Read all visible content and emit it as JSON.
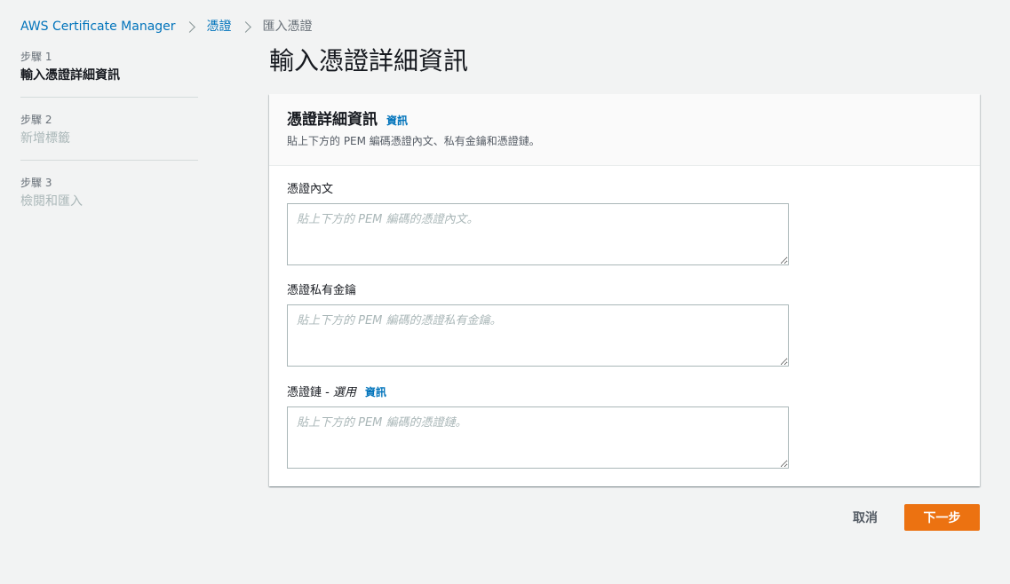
{
  "breadcrumb": {
    "items": [
      "AWS Certificate Manager",
      "憑證"
    ],
    "current": "匯入憑證"
  },
  "steps": [
    {
      "num": "步驟 1",
      "title": "輸入憑證詳細資訊",
      "active": true
    },
    {
      "num": "步驟 2",
      "title": "新增標籤",
      "active": false
    },
    {
      "num": "步驟 3",
      "title": "檢閱和匯入",
      "active": false
    }
  ],
  "page_title": "輸入憑證詳細資訊",
  "panel": {
    "title": "憑證詳細資訊",
    "info_label": "資訊",
    "description": "貼上下方的 PEM 編碼憑證內文、私有金鑰和憑證鏈。"
  },
  "fields": {
    "body": {
      "label": "憑證內文",
      "placeholder": "貼上下方的 PEM 編碼的憑證內文。"
    },
    "private_key": {
      "label": "憑證私有金鑰",
      "placeholder": "貼上下方的 PEM 編碼的憑證私有金鑰。"
    },
    "chain": {
      "label": "憑證鏈 -",
      "optional": "選用",
      "info_label": "資訊",
      "placeholder": "貼上下方的 PEM 編碼的憑證鏈。"
    }
  },
  "actions": {
    "cancel": "取消",
    "next": "下一步"
  },
  "colors": {
    "link": "#0073bb",
    "primary": "#ec7211",
    "background": "#f2f3f3"
  }
}
